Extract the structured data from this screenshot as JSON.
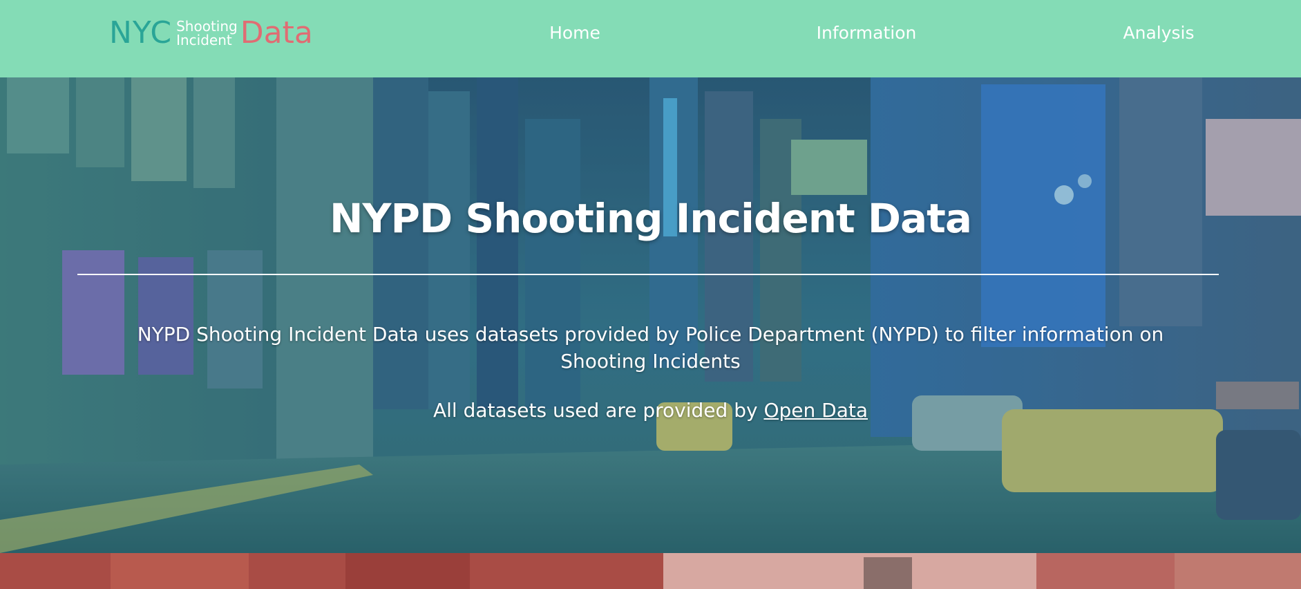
{
  "logo": {
    "nyc": "NYC",
    "line1": "Shooting",
    "line2": "Incident",
    "data": "Data"
  },
  "nav": {
    "home": "Home",
    "information": "Information",
    "analysis": "Analysis"
  },
  "hero": {
    "title": "NYPD Shooting Incident Data",
    "description": "NYPD Shooting Incident Data uses datasets provided by Police Department (NYPD) to filter information on Shooting Incidents",
    "source_prefix": "All datasets used are provided by ",
    "source_link": "Open Data"
  },
  "colors": {
    "navbar_bg": "#84dcb6",
    "logo_nyc": "#2aa597",
    "logo_data": "#e06c73",
    "next_section_tint": "#a94c45"
  }
}
